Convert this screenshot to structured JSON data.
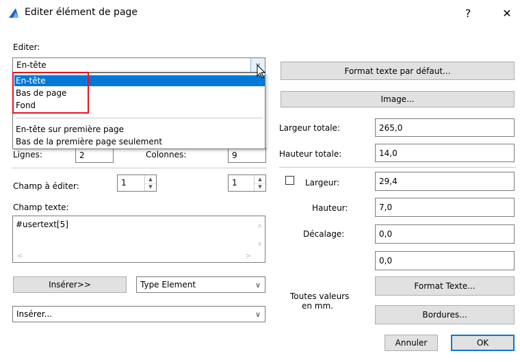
{
  "window": {
    "title": "Editer élément de page",
    "help_label": "?",
    "close_label": "✕"
  },
  "left": {
    "editer_label": "Editer:",
    "editer_value": "En-tête",
    "dropdown_items": [
      "En-tête",
      "Bas de page",
      "Fond",
      "En-tête sur première page",
      "Bas de la première page seulement"
    ],
    "lignes_label": "Lignes:",
    "lignes_value": "2",
    "colonnes_label": "Colonnes:",
    "colonnes_value": "9",
    "champ_label": "Champ à éditer:",
    "champ_value_1": "1",
    "champ_value_2": "1",
    "champ_texte_label": "Champ texte:",
    "champ_texte_value": "#usertext[5]",
    "inserer_button": "Insérer>>",
    "type_element": "Type Element",
    "inserer_combo": "Insérer..."
  },
  "right": {
    "format_defaut_button": "Format texte par défaut...",
    "image_button": "Image...",
    "largeur_totale_label": "Largeur totale:",
    "largeur_totale_value": "265,0",
    "hauteur_totale_label": "Hauteur totale:",
    "hauteur_totale_value": "14,0",
    "largeur_label": "Largeur:",
    "largeur_value": "29,4",
    "hauteur_label": "Hauteur:",
    "hauteur_value": "7,0",
    "decalage_label": "Décalage:",
    "decalage_value": "0,0",
    "extra_value": "0,0",
    "units_note_line1": "Toutes valeurs",
    "units_note_line2": "en mm.",
    "format_texte_button": "Format Texte...",
    "bordures_button": "Bordures...",
    "annuler_button": "Annuler",
    "ok_button": "OK"
  },
  "colors": {
    "accent": "#0078d7",
    "highlight": "#e81123",
    "button_bg": "#e1e1e1"
  }
}
